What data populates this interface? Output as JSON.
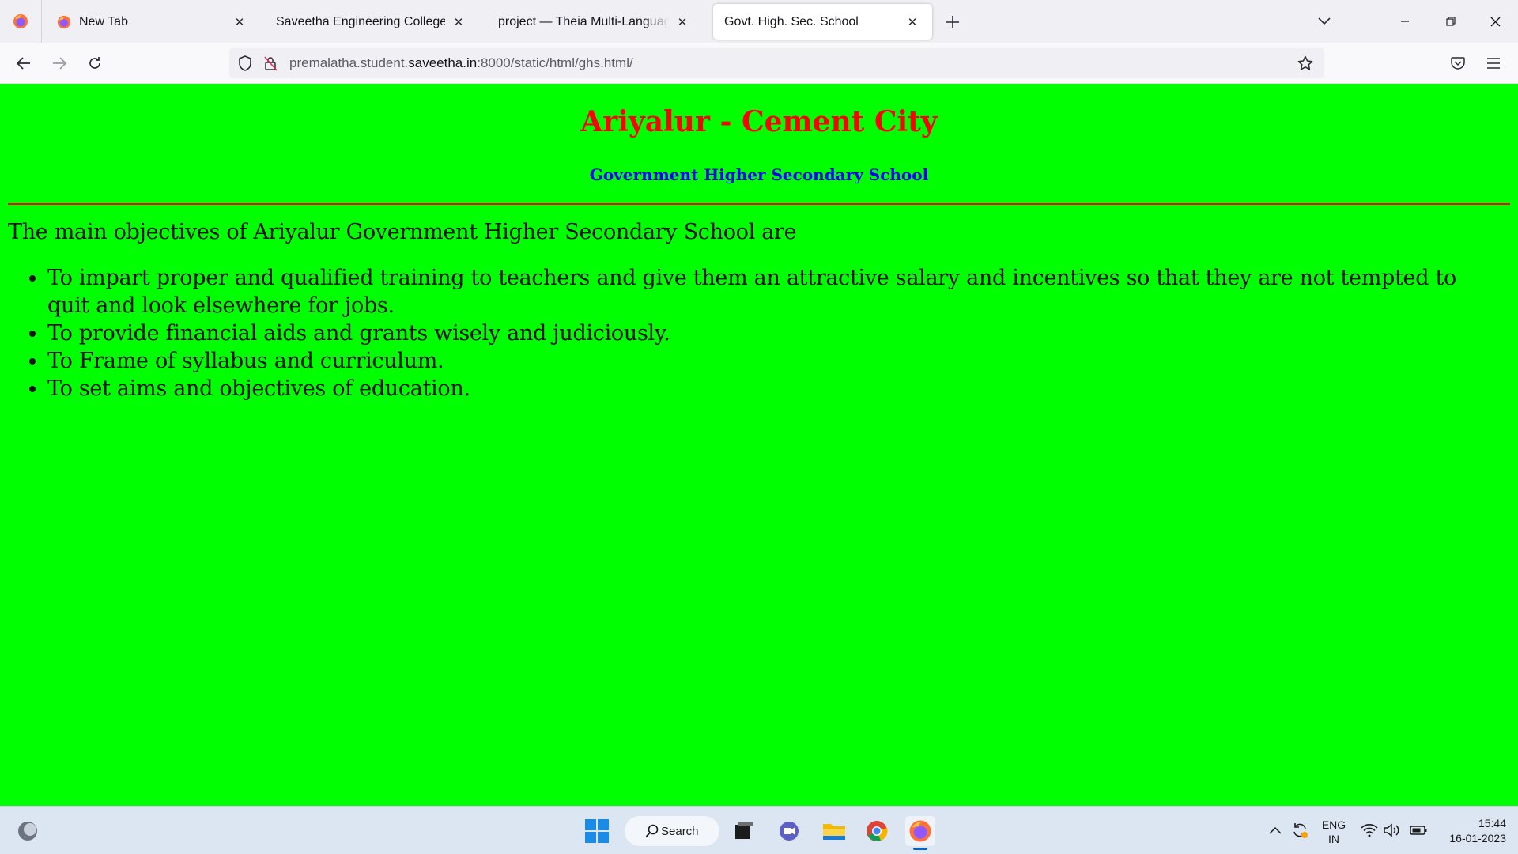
{
  "browser": {
    "tabs": [
      {
        "label": "New Tab",
        "favicon": "firefox-icon"
      },
      {
        "label": "Saveetha Engineering College",
        "favicon": ""
      },
      {
        "label": "project — Theia Multi-Language Ex",
        "favicon": ""
      },
      {
        "label": "Govt. High. Sec. School",
        "favicon": "",
        "active": true
      }
    ],
    "url": {
      "prefix": "premalatha.student.",
      "host": "saveetha.in",
      "suffix": ":8000/static/html/ghs.html/"
    }
  },
  "page": {
    "background": "#00ff00",
    "title": "Ariyalur - Cement City",
    "title_color": "#ff0000",
    "subtitle": "Government Higher Secondary School",
    "subtitle_color": "#0000ff",
    "intro": "The main objectives of Ariyalur Government Higher Secondary School are",
    "objectives": [
      "To impart proper and qualified training to teachers and give them an attractive salary and incentives so that they are not tempted to quit and look elsewhere for jobs.",
      "To provide financial aids and grants wisely and judiciously.",
      "To Frame of syllabus and curriculum.",
      "To set aims and objectives of education."
    ]
  },
  "taskbar": {
    "search_label": "Search",
    "language": {
      "line1": "ENG",
      "line2": "IN"
    },
    "time": "15:44",
    "date": "16-01-2023"
  }
}
